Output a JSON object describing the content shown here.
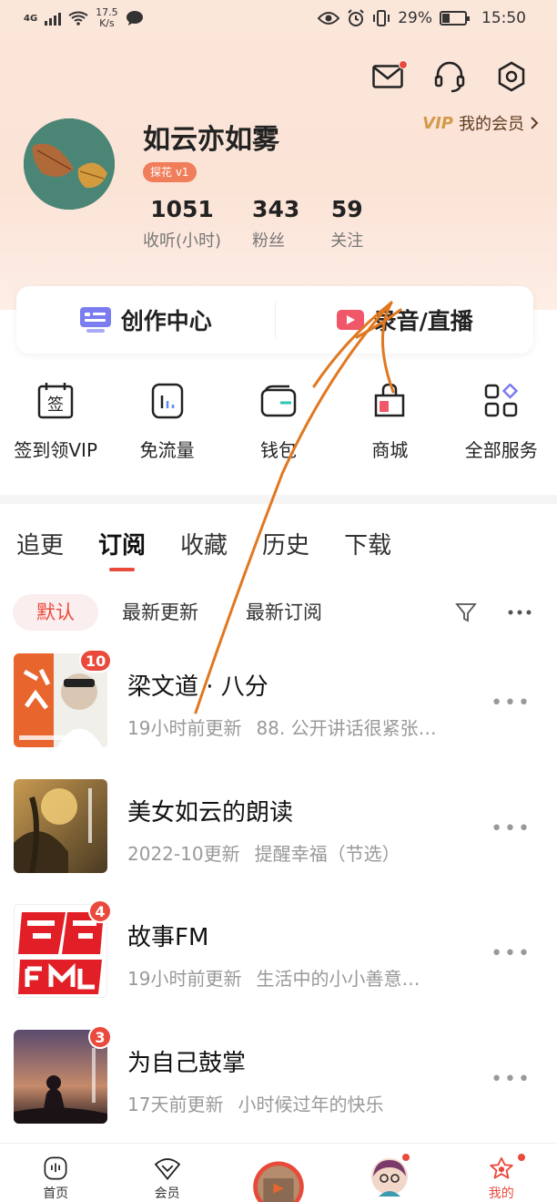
{
  "status_bar": {
    "network": "4G",
    "speed_value": "17.5",
    "speed_unit": "K/s",
    "battery": "29%",
    "time": "15:50"
  },
  "header": {
    "icons": [
      "mail-icon",
      "headset-icon",
      "settings-hex-icon"
    ],
    "vip_logo": "VIP",
    "vip_label": "我的会员"
  },
  "profile": {
    "name": "如云亦如雾",
    "level": "探花 v1",
    "stats": [
      {
        "value": "1051",
        "label": "收听(小时)"
      },
      {
        "value": "343",
        "label": "粉丝"
      },
      {
        "value": "59",
        "label": "关注"
      }
    ]
  },
  "creation": {
    "create_center": "创作中心",
    "record_live": "录音/直播"
  },
  "services": [
    {
      "label": "签到领VIP",
      "icon": "checkin-icon",
      "glyph": "签"
    },
    {
      "label": "免流量",
      "icon": "data-free-icon",
      "glyph": ""
    },
    {
      "label": "钱包",
      "icon": "wallet-icon",
      "glyph": ""
    },
    {
      "label": "商城",
      "icon": "mall-icon",
      "glyph": ""
    },
    {
      "label": "全部服务",
      "icon": "all-services-icon",
      "glyph": ""
    }
  ],
  "tabs": [
    "追更",
    "订阅",
    "收藏",
    "历史",
    "下载"
  ],
  "active_tab": "订阅",
  "filters": [
    "默认",
    "最新更新",
    "最新订阅"
  ],
  "subscriptions": [
    {
      "title": "梁文道 · 八分",
      "time": "19小时前更新",
      "episode": "88. 公开讲话很紧张…",
      "badge": "10"
    },
    {
      "title": "美女如云的朗读",
      "time": "2022-10更新",
      "episode": "提醒幸福（节选）",
      "badge": ""
    },
    {
      "title": "故事FM",
      "time": "19小时前更新",
      "episode": "生活中的小小善意…",
      "badge": "4"
    },
    {
      "title": "为自己鼓掌",
      "time": "17天前更新",
      "episode": "小时候过年的快乐",
      "badge": "3"
    }
  ],
  "bottom_nav": {
    "home": "首页",
    "member": "会员",
    "mine": "我的"
  },
  "colors": {
    "accent": "#e94a3c",
    "header_bg": "#fbe6da"
  }
}
